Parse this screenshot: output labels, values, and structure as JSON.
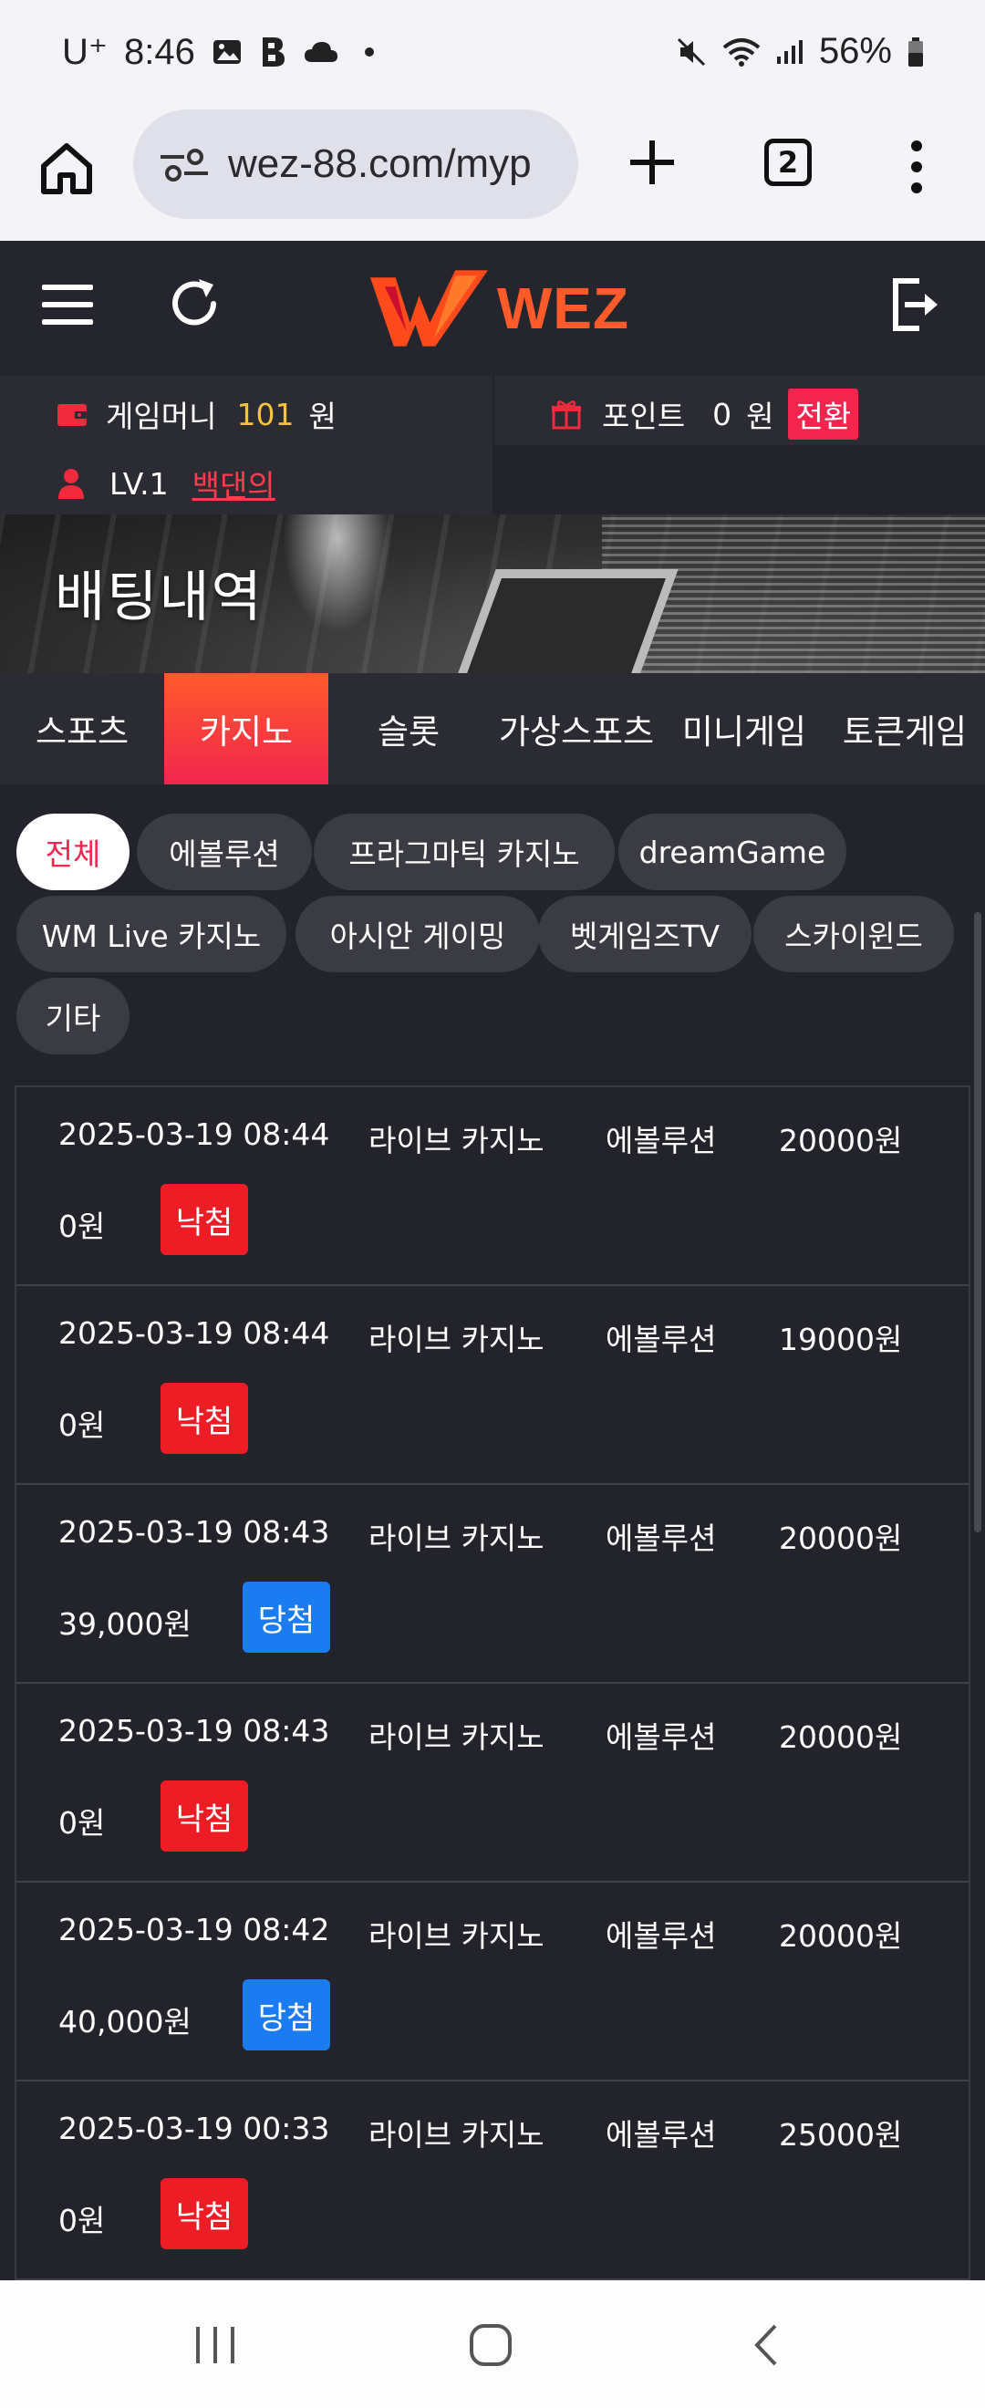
{
  "status_bar": {
    "carrier": "U⁺",
    "time": "8:46",
    "battery": "56%"
  },
  "browser": {
    "url": "wez-88.com/myp",
    "tab_count": "2"
  },
  "header": {
    "logo_text": "WEZ"
  },
  "account": {
    "money_label": "게임머니",
    "money_value": "101",
    "money_unit": "원",
    "point_label": "포인트",
    "point_value": "0",
    "point_unit": "원",
    "switch_label": "전환",
    "level": "LV.1",
    "nickname": "백댄의"
  },
  "banner": {
    "title": "배팅내역",
    "colors": {
      "accent": "#f2254e",
      "accent2": "#ff5a2a"
    }
  },
  "categories": [
    {
      "label": "스포츠",
      "active": false
    },
    {
      "label": "카지노",
      "active": true
    },
    {
      "label": "슬롯",
      "active": false
    },
    {
      "label": "가상스포츠",
      "active": false
    },
    {
      "label": "미니게임",
      "active": false
    },
    {
      "label": "토큰게임",
      "active": false
    }
  ],
  "providers": [
    {
      "label": "전체",
      "active": true
    },
    {
      "label": "에볼루션",
      "active": false
    },
    {
      "label": "프라그마틱 카지노",
      "active": false
    },
    {
      "label": "dreamGame",
      "active": false
    },
    {
      "label": "WM Live 카지노",
      "active": false
    },
    {
      "label": "아시안 게이밍",
      "active": false
    },
    {
      "label": "벳게임즈TV",
      "active": false
    },
    {
      "label": "스카이윈드",
      "active": false
    },
    {
      "label": "기타",
      "active": false
    }
  ],
  "bets": [
    {
      "datetime": "2025-03-19 08:44",
      "type": "라이브 카지노",
      "provider": "에볼루션",
      "amount": "20000원",
      "payout": "0원",
      "result": "낙첨",
      "result_color": "#ee1c24"
    },
    {
      "datetime": "2025-03-19 08:44",
      "type": "라이브 카지노",
      "provider": "에볼루션",
      "amount": "19000원",
      "payout": "0원",
      "result": "낙첨",
      "result_color": "#ee1c24"
    },
    {
      "datetime": "2025-03-19 08:43",
      "type": "라이브 카지노",
      "provider": "에볼루션",
      "amount": "20000원",
      "payout": "39,000원",
      "result": "당첨",
      "result_color": "#1a7cf0"
    },
    {
      "datetime": "2025-03-19 08:43",
      "type": "라이브 카지노",
      "provider": "에볼루션",
      "amount": "20000원",
      "payout": "0원",
      "result": "낙첨",
      "result_color": "#ee1c24"
    },
    {
      "datetime": "2025-03-19 08:42",
      "type": "라이브 카지노",
      "provider": "에볼루션",
      "amount": "20000원",
      "payout": "40,000원",
      "result": "당첨",
      "result_color": "#1a7cf0"
    },
    {
      "datetime": "2025-03-19 00:33",
      "type": "라이브 카지노",
      "provider": "에볼루션",
      "amount": "25000원",
      "payout": "0원",
      "result": "낙첨",
      "result_color": "#ee1c24"
    }
  ]
}
